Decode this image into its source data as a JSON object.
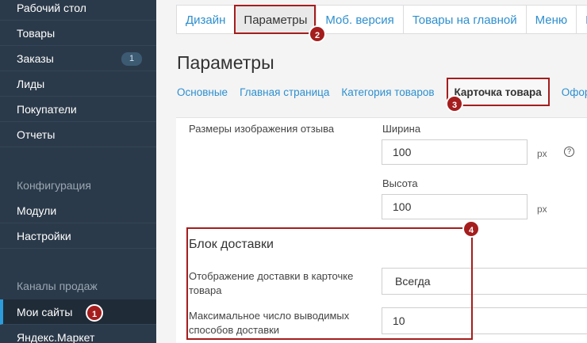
{
  "sidebar": {
    "items": [
      {
        "label": "Рабочий стол"
      },
      {
        "label": "Товары"
      },
      {
        "label": "Заказы",
        "badge": "1"
      },
      {
        "label": "Лиды"
      },
      {
        "label": "Покупатели"
      },
      {
        "label": "Отчеты"
      }
    ],
    "group_config": "Конфигурация",
    "config_items": [
      {
        "label": "Модули"
      },
      {
        "label": "Настройки"
      }
    ],
    "group_channels": "Каналы продаж",
    "channel_items": [
      {
        "label": "Мои сайты",
        "active": true
      },
      {
        "label": "Яндекс.Маркет"
      }
    ]
  },
  "tabs": [
    {
      "label": "Дизайн"
    },
    {
      "label": "Параметры",
      "active": true
    },
    {
      "label": "Моб. версия"
    },
    {
      "label": "Товары на главной"
    },
    {
      "label": "Меню"
    },
    {
      "label": "К"
    }
  ],
  "page_title": "Параметры",
  "subtabs": [
    {
      "label": "Основные"
    },
    {
      "label": "Главная страница"
    },
    {
      "label": "Категория товаров"
    },
    {
      "label": "Карточка товара",
      "active": true
    },
    {
      "label": "Офор"
    }
  ],
  "review_images": {
    "label": "Размеры изображения отзыва",
    "width_label": "Ширина",
    "width_value": "100",
    "height_label": "Высота",
    "height_value": "100",
    "unit": "px",
    "help": "?"
  },
  "delivery": {
    "title": "Блок доставки",
    "display_label": "Отображение доставки в карточке товара",
    "display_value": "Всегда",
    "max_label": "Максимальное число выводимых способов доставки",
    "max_value": "10"
  },
  "markers": [
    "1",
    "2",
    "3",
    "4"
  ],
  "colors": {
    "sidebar": "#2b3a4a",
    "accent": "#2d8fcf",
    "annotation": "#a51d1d"
  }
}
